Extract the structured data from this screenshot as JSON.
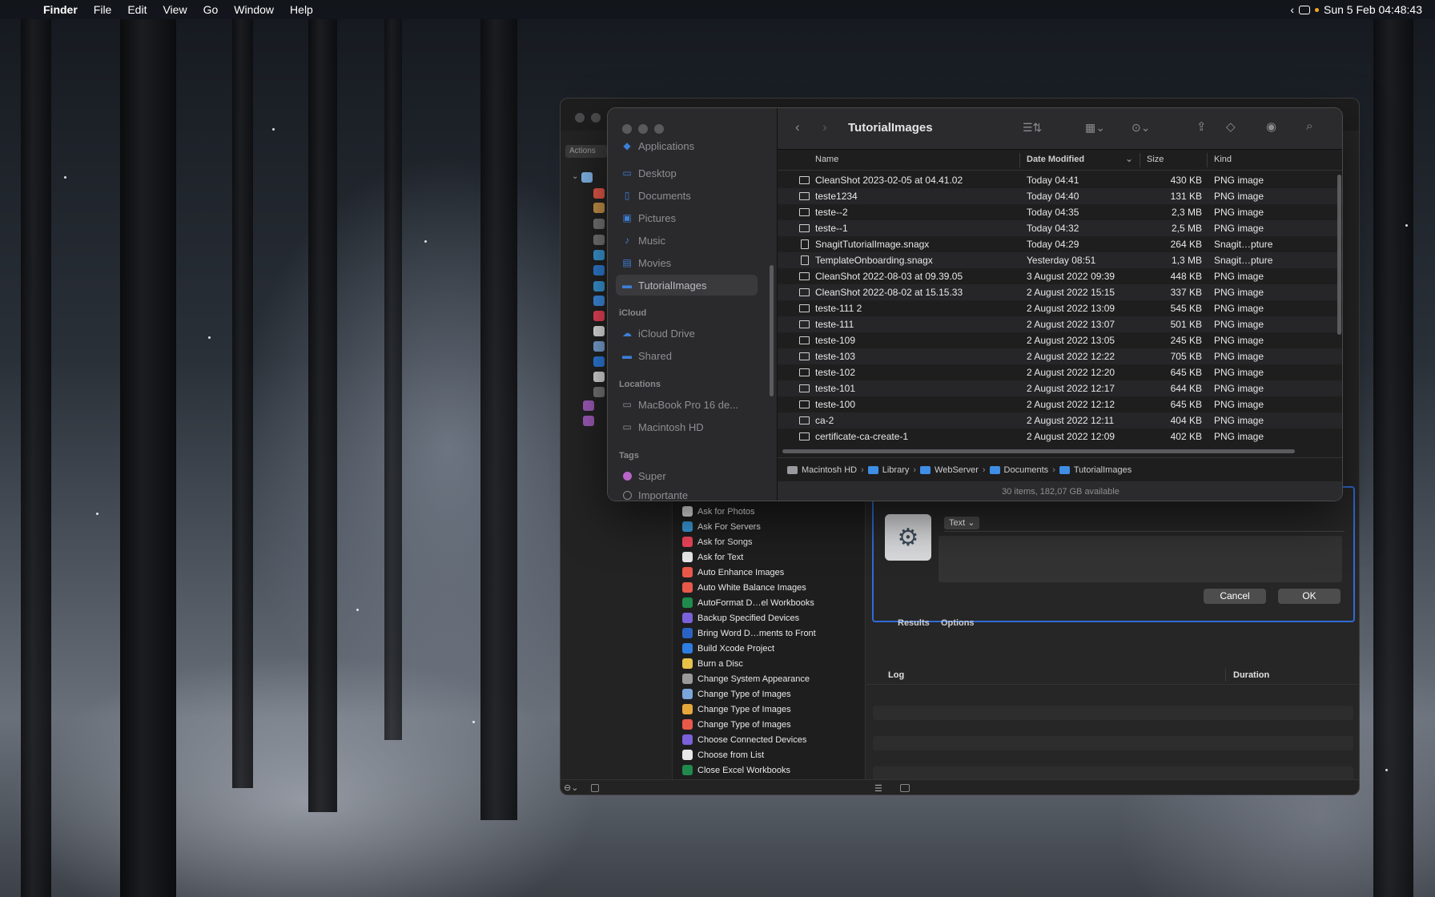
{
  "menubar": {
    "apple": "",
    "app": "Finder",
    "items": [
      "File",
      "Edit",
      "View",
      "Go",
      "Window",
      "Help"
    ],
    "clock": "Sun 5 Feb  04:48:43",
    "arrow": "‹"
  },
  "finder": {
    "title": "TutorialImages",
    "sidebar": {
      "favorites": [
        {
          "label": "Applications",
          "icon": "applications-icon"
        },
        {
          "label": "Desktop",
          "icon": "desktop-icon"
        },
        {
          "label": "Documents",
          "icon": "documents-icon"
        },
        {
          "label": "Pictures",
          "icon": "pictures-icon"
        },
        {
          "label": "Music",
          "icon": "music-icon"
        },
        {
          "label": "Movies",
          "icon": "movies-icon"
        },
        {
          "label": "TutorialImages",
          "icon": "folder-icon",
          "selected": true
        }
      ],
      "icloud_heading": "iCloud",
      "icloud": [
        {
          "label": "iCloud Drive",
          "icon": "cloud-icon"
        },
        {
          "label": "Shared",
          "icon": "shared-folder-icon"
        }
      ],
      "locations_heading": "Locations",
      "locations": [
        {
          "label": "MacBook Pro 16 de...",
          "icon": "laptop-icon"
        },
        {
          "label": "Macintosh HD",
          "icon": "disk-icon"
        }
      ],
      "tags_heading": "Tags",
      "tags": [
        {
          "label": "Super",
          "color": "#b865c9"
        },
        {
          "label": "Importante",
          "color": "hollow"
        }
      ]
    },
    "columns": {
      "name": "Name",
      "date": "Date Modified",
      "size": "Size",
      "kind": "Kind"
    },
    "files": [
      {
        "name": "CleanShot 2023-02-05 at 04.41.02",
        "date": "Today 04:41",
        "size": "430 KB",
        "kind": "PNG image",
        "type": "image"
      },
      {
        "name": "teste1234",
        "date": "Today 04:40",
        "size": "131 KB",
        "kind": "PNG image",
        "type": "image"
      },
      {
        "name": "teste--2",
        "date": "Today 04:35",
        "size": "2,3 MB",
        "kind": "PNG image",
        "type": "image"
      },
      {
        "name": "teste--1",
        "date": "Today 04:32",
        "size": "2,5 MB",
        "kind": "PNG image",
        "type": "image"
      },
      {
        "name": "SnagitTutorialImage.snagx",
        "date": "Today 04:29",
        "size": "264 KB",
        "kind": "Snagit…pture",
        "type": "doc"
      },
      {
        "name": "TemplateOnboarding.snagx",
        "date": "Yesterday 08:51",
        "size": "1,3 MB",
        "kind": "Snagit…pture",
        "type": "doc"
      },
      {
        "name": "CleanShot 2022-08-03 at 09.39.05",
        "date": "3 August 2022 09:39",
        "size": "448 KB",
        "kind": "PNG image",
        "type": "image"
      },
      {
        "name": "CleanShot 2022-08-02 at 15.15.33",
        "date": "2 August 2022 15:15",
        "size": "337 KB",
        "kind": "PNG image",
        "type": "image"
      },
      {
        "name": "teste-111 2",
        "date": "2 August 2022 13:09",
        "size": "545 KB",
        "kind": "PNG image",
        "type": "image"
      },
      {
        "name": "teste-111",
        "date": "2 August 2022 13:07",
        "size": "501 KB",
        "kind": "PNG image",
        "type": "image"
      },
      {
        "name": "teste-109",
        "date": "2 August 2022 13:05",
        "size": "245 KB",
        "kind": "PNG image",
        "type": "image"
      },
      {
        "name": "teste-103",
        "date": "2 August 2022 12:22",
        "size": "705 KB",
        "kind": "PNG image",
        "type": "image"
      },
      {
        "name": "teste-102",
        "date": "2 August 2022 12:20",
        "size": "645 KB",
        "kind": "PNG image",
        "type": "image"
      },
      {
        "name": "teste-101",
        "date": "2 August 2022 12:17",
        "size": "644 KB",
        "kind": "PNG image",
        "type": "image"
      },
      {
        "name": "teste-100",
        "date": "2 August 2022 12:12",
        "size": "645 KB",
        "kind": "PNG image",
        "type": "image"
      },
      {
        "name": "ca-2",
        "date": "2 August 2022 12:11",
        "size": "404 KB",
        "kind": "PNG image",
        "type": "image"
      },
      {
        "name": "certificate-ca-create-1",
        "date": "2 August 2022 12:09",
        "size": "402 KB",
        "kind": "PNG image",
        "type": "image"
      }
    ],
    "path": [
      "Macintosh HD",
      "Library",
      "WebServer",
      "Documents",
      "TutorialImages"
    ],
    "status": "30 items, 182,07 GB available"
  },
  "automator": {
    "actions_tab": "Actions",
    "actions": [
      {
        "label": "Ask for Photos",
        "color": "#e8e8e8"
      },
      {
        "label": "Ask For Servers",
        "color": "#3a9ad9"
      },
      {
        "label": "Ask for Songs",
        "color": "#f0455a"
      },
      {
        "label": "Ask for Text",
        "color": "#e8e8e8"
      },
      {
        "label": "Auto Enhance Images",
        "color": "#e9594a"
      },
      {
        "label": "Auto White Balance Images",
        "color": "#e9594a"
      },
      {
        "label": "AutoFormat D…el Workbooks",
        "color": "#1f8a4c"
      },
      {
        "label": "Backup Specified Devices",
        "color": "#7b61d9"
      },
      {
        "label": "Bring Word D…ments to Front",
        "color": "#2b63c4"
      },
      {
        "label": "Build Xcode Project",
        "color": "#2d7ee0"
      },
      {
        "label": "Burn a Disc",
        "color": "#e6c24a"
      },
      {
        "label": "Change System Appearance",
        "color": "#9a9a9a"
      },
      {
        "label": "Change Type of Images",
        "color": "#7ba6d9"
      },
      {
        "label": "Change Type of Images",
        "color": "#e6a83a"
      },
      {
        "label": "Change Type of Images",
        "color": "#e9594a"
      },
      {
        "label": "Choose Connected Devices",
        "color": "#7b61d9"
      },
      {
        "label": "Choose from List",
        "color": "#e8e8e8"
      },
      {
        "label": "Close Excel Workbooks",
        "color": "#1f8a4c"
      }
    ],
    "text_popup": "Text ⌄",
    "cancel": "Cancel",
    "ok": "OK",
    "tab_results": "Results",
    "tab_options": "Options",
    "log": "Log",
    "duration": "Duration"
  }
}
